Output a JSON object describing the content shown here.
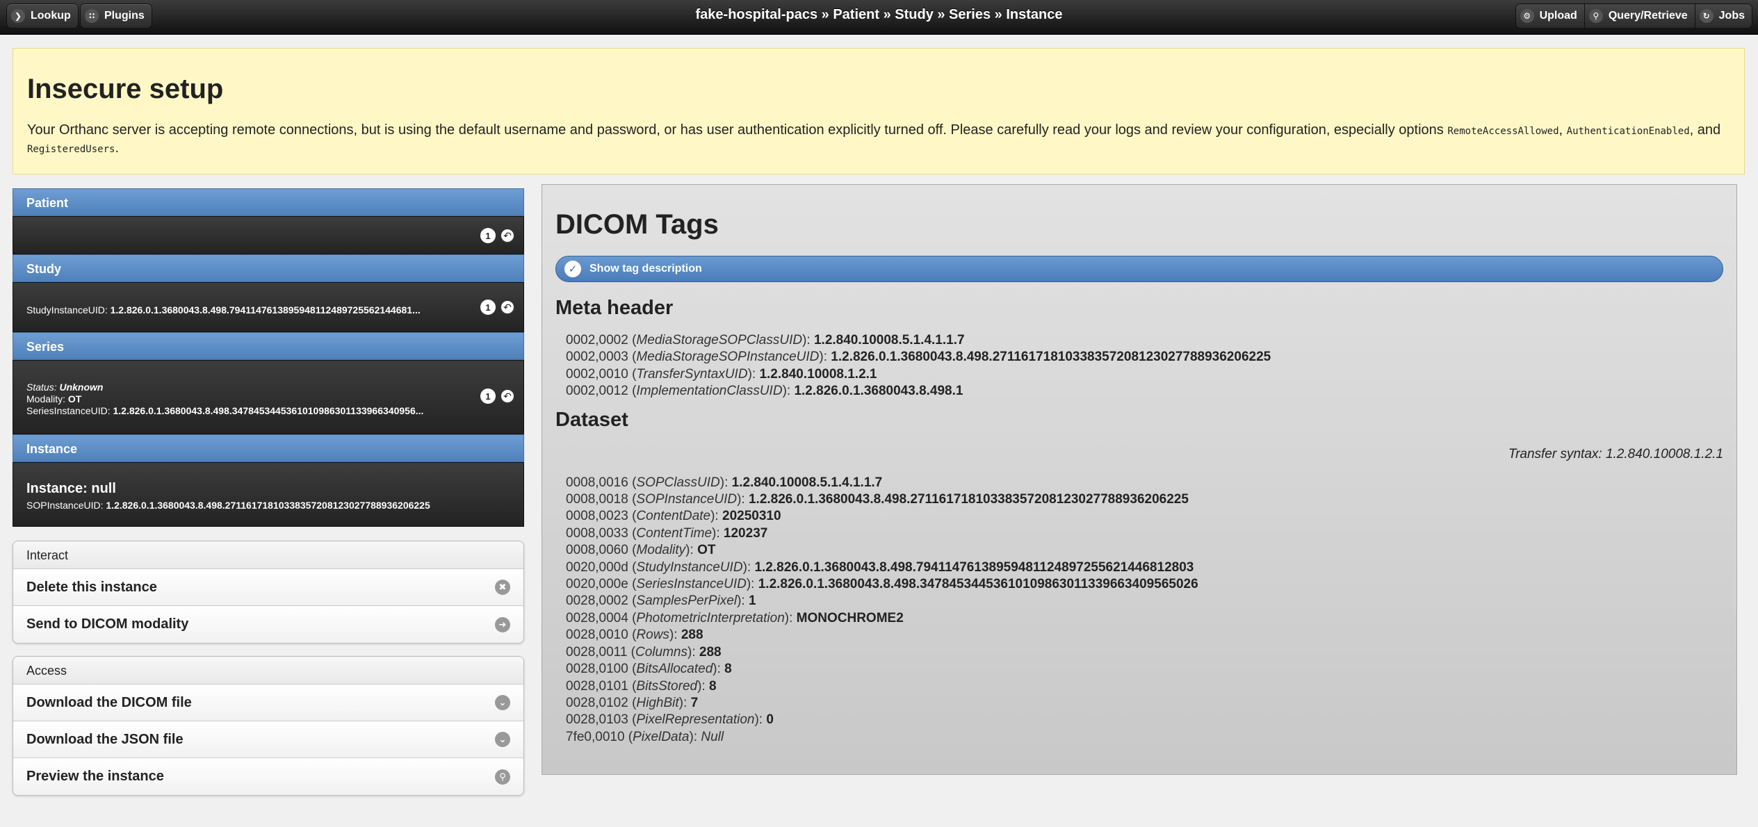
{
  "topbar": {
    "lookup": "Lookup",
    "plugins": "Plugins",
    "breadcrumb": "fake-hospital-pacs » Patient » Study » Series » Instance",
    "upload": "Upload",
    "query": "Query/Retrieve",
    "jobs": "Jobs"
  },
  "warning": {
    "title": "Insecure setup",
    "text": "Your Orthanc server is accepting remote connections, but is using the default username and password, or has user authentication explicitly turned off. Please carefully read your logs and review your configuration, especially options ",
    "opt1": "RemoteAccessAllowed",
    "sep1": ", ",
    "opt2": "AuthenticationEnabled",
    "sep2": ", and ",
    "opt3": "RegisteredUsers",
    "end": "."
  },
  "patient": {
    "header": "Patient",
    "count": "1"
  },
  "study": {
    "header": "Study",
    "uid_label": "StudyInstanceUID: ",
    "uid": "1.2.826.0.1.3680043.8.498.7941147613895948112489725562144681...",
    "count": "1"
  },
  "series": {
    "header": "Series",
    "status_label": "Status: ",
    "status": "Unknown",
    "modality_label": "Modality: ",
    "modality": "OT",
    "uid_label": "SeriesInstanceUID: ",
    "uid": "1.2.826.0.1.3680043.8.498.3478453445361010986301133966340956...",
    "count": "1"
  },
  "instance": {
    "header": "Instance",
    "title": "Instance: null",
    "uid_label": "SOPInstanceUID: ",
    "uid": "1.2.826.0.1.3680043.8.498.27116171810338357208123027788936206225"
  },
  "interact": {
    "header": "Interact",
    "delete": "Delete this instance",
    "send": "Send to DICOM modality"
  },
  "access": {
    "header": "Access",
    "download_dicom": "Download the DICOM file",
    "download_json": "Download the JSON file",
    "preview": "Preview the instance"
  },
  "main": {
    "title": "DICOM Tags",
    "toggle_label": "Show tag description",
    "meta_header": "Meta header",
    "dataset_header": "Dataset",
    "transfer_syntax": "Transfer syntax: 1.2.840.10008.1.2.1",
    "meta_tags": [
      {
        "tag": "0002,0002",
        "name": "MediaStorageSOPClassUID",
        "value": "1.2.840.10008.5.1.4.1.1.7"
      },
      {
        "tag": "0002,0003",
        "name": "MediaStorageSOPInstanceUID",
        "value": "1.2.826.0.1.3680043.8.498.27116171810338357208123027788936206225"
      },
      {
        "tag": "0002,0010",
        "name": "TransferSyntaxUID",
        "value": "1.2.840.10008.1.2.1"
      },
      {
        "tag": "0002,0012",
        "name": "ImplementationClassUID",
        "value": "1.2.826.0.1.3680043.8.498.1"
      }
    ],
    "dataset_tags": [
      {
        "tag": "0008,0016",
        "name": "SOPClassUID",
        "value": "1.2.840.10008.5.1.4.1.1.7"
      },
      {
        "tag": "0008,0018",
        "name": "SOPInstanceUID",
        "value": "1.2.826.0.1.3680043.8.498.27116171810338357208123027788936206225"
      },
      {
        "tag": "0008,0023",
        "name": "ContentDate",
        "value": "20250310"
      },
      {
        "tag": "0008,0033",
        "name": "ContentTime",
        "value": "120237"
      },
      {
        "tag": "0008,0060",
        "name": "Modality",
        "value": "OT"
      },
      {
        "tag": "0020,000d",
        "name": "StudyInstanceUID",
        "value": "1.2.826.0.1.3680043.8.498.79411476138959481124897255621446812803"
      },
      {
        "tag": "0020,000e",
        "name": "SeriesInstanceUID",
        "value": "1.2.826.0.1.3680043.8.498.34784534453610109863011339663409565026"
      },
      {
        "tag": "0028,0002",
        "name": "SamplesPerPixel",
        "value": "1"
      },
      {
        "tag": "0028,0004",
        "name": "PhotometricInterpretation",
        "value": "MONOCHROME2"
      },
      {
        "tag": "0028,0010",
        "name": "Rows",
        "value": "288"
      },
      {
        "tag": "0028,0011",
        "name": "Columns",
        "value": "288"
      },
      {
        "tag": "0028,0100",
        "name": "BitsAllocated",
        "value": "8"
      },
      {
        "tag": "0028,0101",
        "name": "BitsStored",
        "value": "8"
      },
      {
        "tag": "0028,0102",
        "name": "HighBit",
        "value": "7"
      },
      {
        "tag": "0028,0103",
        "name": "PixelRepresentation",
        "value": "0"
      },
      {
        "tag": "7fe0,0010",
        "name": "PixelData",
        "value": "Null",
        "plain": true
      }
    ]
  },
  "icons": {
    "lookup": "chevron-right-icon",
    "plugins": "grid-icon",
    "upload": "gear-icon",
    "query": "search-icon",
    "jobs": "refresh-icon"
  },
  "colors": {
    "topbar": "#1e1e1e",
    "warning_bg": "#fff8c6",
    "accent_blue": "#5585c1"
  }
}
